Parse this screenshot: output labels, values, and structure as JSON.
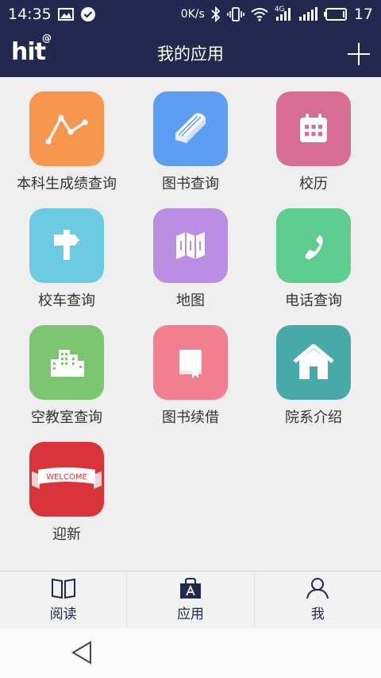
{
  "status_bar": {
    "time": "14:35",
    "speed": "0K/s",
    "network": "4G",
    "battery": "17",
    "icons": [
      "image-icon",
      "check-circle-icon",
      "bluetooth-icon",
      "vibrate-icon",
      "wifi-icon",
      "signal-icon",
      "battery-icon"
    ]
  },
  "header": {
    "logo_text": "hit",
    "logo_mark": "@",
    "title": "我的应用",
    "add_icon": "plus-icon"
  },
  "apps": [
    {
      "label": "本科生成绩查询",
      "icon": "line-chart-icon",
      "color": "#f7964f"
    },
    {
      "label": "图书查询",
      "icon": "book-icon",
      "color": "#5c9ff2"
    },
    {
      "label": "校历",
      "icon": "calendar-icon",
      "color": "#d86d94"
    },
    {
      "label": "校车查询",
      "icon": "signpost-icon",
      "color": "#6ccbe3"
    },
    {
      "label": "地图",
      "icon": "map-icon",
      "color": "#bb8de3"
    },
    {
      "label": "电话查询",
      "icon": "phone-icon",
      "color": "#5ecb8f"
    },
    {
      "label": "空教室查询",
      "icon": "buildings-icon",
      "color": "#7cc672"
    },
    {
      "label": "图书续借",
      "icon": "bookmark-book-icon",
      "color": "#f27f8f"
    },
    {
      "label": "院系介绍",
      "icon": "house-icon",
      "color": "#48aaa9"
    },
    {
      "label": "迎新",
      "icon": "welcome-banner-icon",
      "color": "#d8343a",
      "banner_text": "WELCOME"
    }
  ],
  "bottom_nav": {
    "items": [
      {
        "label": "阅读",
        "icon": "open-book-icon"
      },
      {
        "label": "应用",
        "icon": "app-bag-icon"
      },
      {
        "label": "我",
        "icon": "person-icon"
      }
    ]
  },
  "colors": {
    "header_bg": "#22284e",
    "page_bg": "#efefef"
  }
}
